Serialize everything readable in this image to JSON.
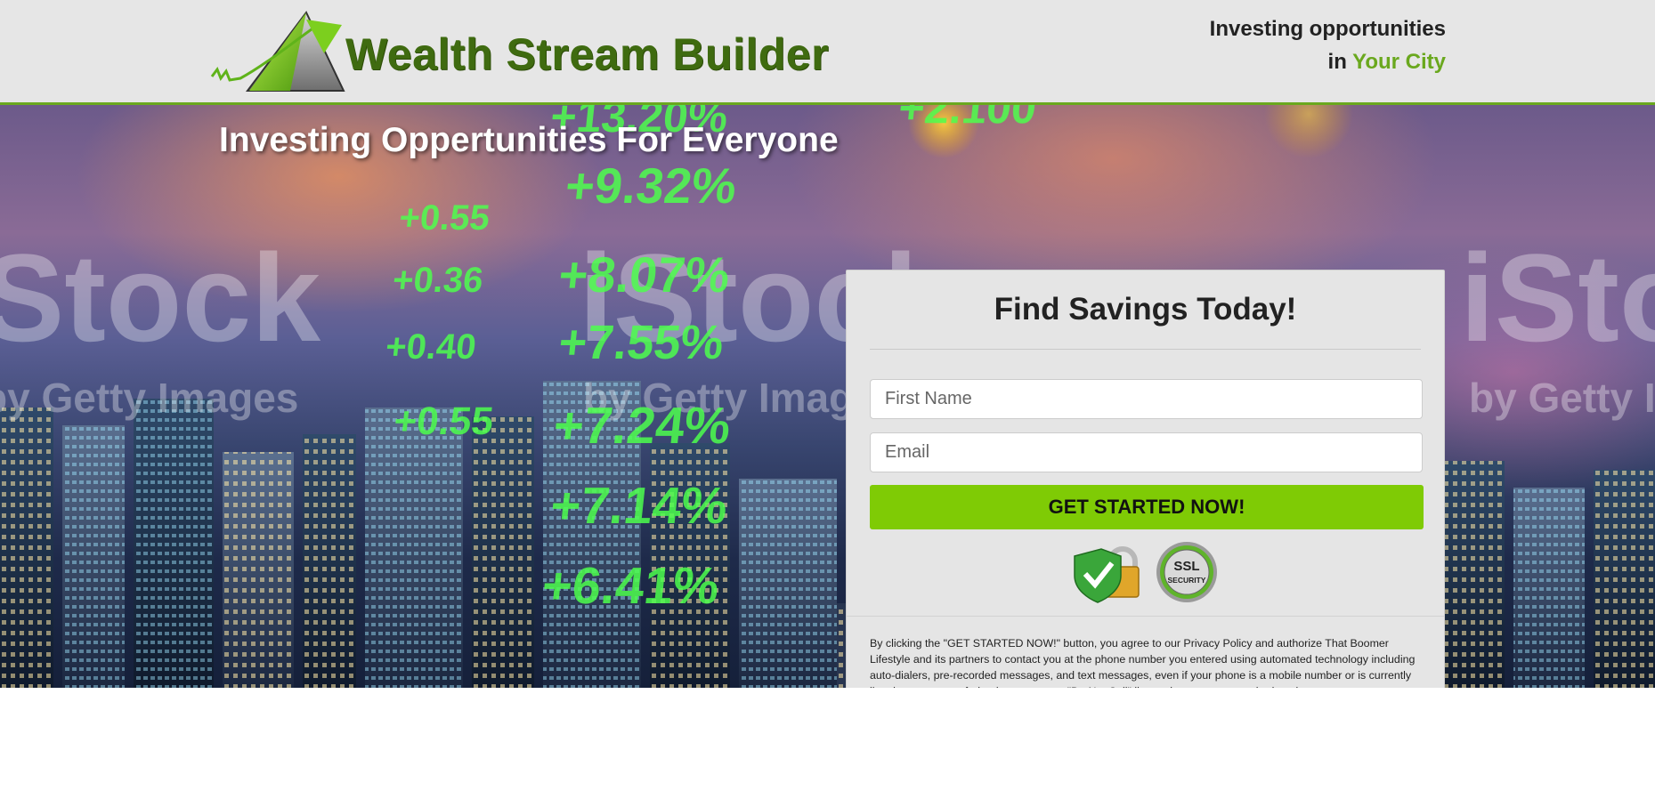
{
  "header": {
    "brand": "Wealth Stream Builder",
    "tagline_line1": "Investing opportunities",
    "tagline_in": "in ",
    "tagline_city": "Your City"
  },
  "hero": {
    "title": "Investing Oppertunities For Everyone",
    "watermark_big": "iStock",
    "watermark_sub": "by Getty Images",
    "ticker_values": [
      "+13.20%",
      "+9.32%",
      "+0.55",
      "+8.07%",
      "+0.36",
      "+7.55%",
      "+0.40",
      "+7.24%",
      "+0.55",
      "+7.14%",
      "+6.41%",
      "+2.100"
    ]
  },
  "form": {
    "title": "Find Savings Today!",
    "first_name_placeholder": "First Name",
    "email_placeholder": "Email",
    "submit_label": "GET STARTED NOW!",
    "ssl_badge_line1": "SSL",
    "ssl_badge_line2": "SECURITY",
    "legal": "By clicking the \"GET STARTED NOW!\" button, you agree to our Privacy Policy and authorize That Boomer Lifestyle and its partners to contact you at the phone number you entered using automated technology including auto-dialers, pre-recorded messages, and text messages, even if your phone is a mobile number or is currently listed on any state, federal, or corporate \"Do Not Call\" list, and you are not required to give your consent as a condition of service."
  },
  "colors": {
    "accent_green": "#6aa81e",
    "cta_green": "#7fcb05",
    "header_bg": "#e6e6e6"
  },
  "icons": [
    "logo-triangle-arrow-icon",
    "secure-padlock-check-icon",
    "ssl-security-seal-icon"
  ]
}
